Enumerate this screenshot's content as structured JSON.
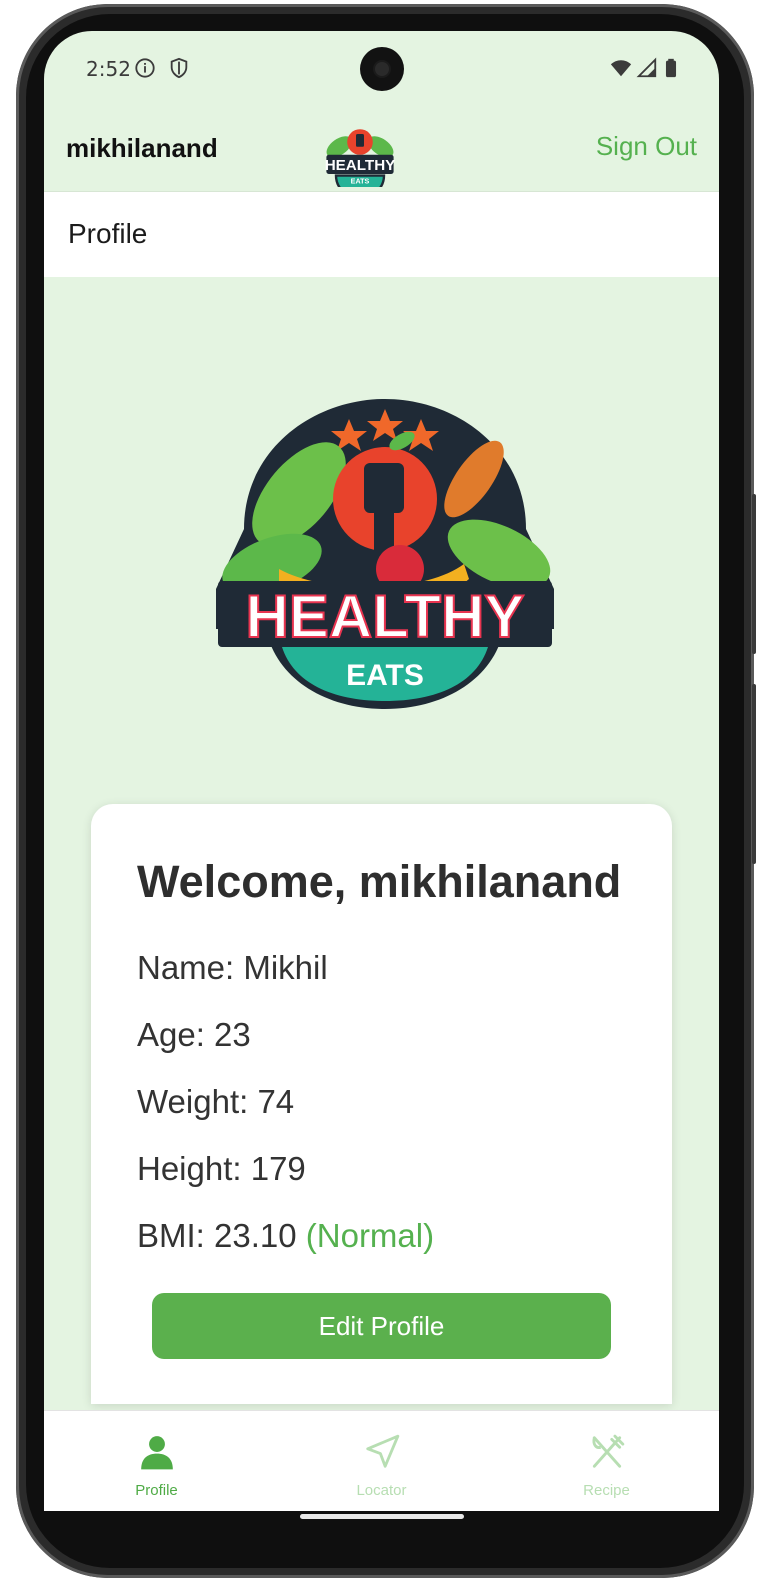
{
  "status_bar": {
    "time": "2:52"
  },
  "header": {
    "username": "mikhilanand",
    "sign_out_label": "Sign Out"
  },
  "page": {
    "title": "Profile"
  },
  "logo": {
    "text_main": "HEALTHY",
    "text_sub": "EATS"
  },
  "profile": {
    "welcome": "Welcome, mikhilanand",
    "name": "Name: Mikhil",
    "age": "Age: 23",
    "weight": "Weight: 74",
    "height": "Height: 179",
    "bmi": "BMI: 23.10",
    "bmi_status": "(Normal)",
    "edit_label": "Edit Profile"
  },
  "nav": {
    "items": [
      {
        "label": "Profile",
        "icon": "person-icon",
        "active": true
      },
      {
        "label": "Locator",
        "icon": "navigation-arrow-icon",
        "active": false
      },
      {
        "label": "Recipe",
        "icon": "fork-knife-icon",
        "active": false
      }
    ]
  },
  "colors": {
    "accent": "#55b14f",
    "button": "#5bb04d",
    "background": "#e4f4e1",
    "nav_inactive": "#b7deb2"
  }
}
